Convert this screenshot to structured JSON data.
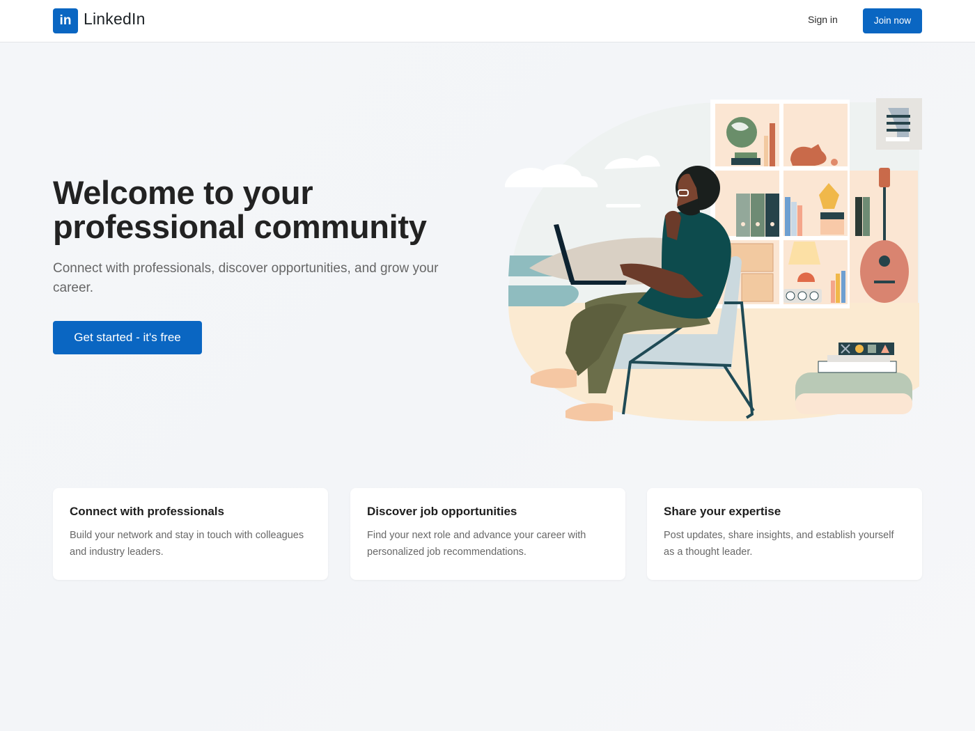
{
  "header": {
    "logo_mark": "in",
    "logo_text": "LinkedIn",
    "signin_label": "Sign in",
    "join_label": "Join now"
  },
  "hero": {
    "title": "Welcome to your professional community",
    "subtitle": "Connect with professionals, discover opportunities, and grow your career.",
    "cta_label": "Get started - it's free"
  },
  "cards": [
    {
      "title": "Connect with professionals",
      "body": "Build your network and stay in touch with colleagues and industry leaders."
    },
    {
      "title": "Discover job opportunities",
      "body": "Find your next role and advance your career with personalized job recommendations."
    },
    {
      "title": "Share your expertise",
      "body": "Post updates, share insights, and establish yourself as a thought leader."
    }
  ],
  "colors": {
    "brand": "#0a66c2",
    "header_bg": "#ffffff",
    "page_bg": "#f4f6f9"
  },
  "illustration": {
    "icon_name": "person-working-on-laptop-illustration"
  }
}
